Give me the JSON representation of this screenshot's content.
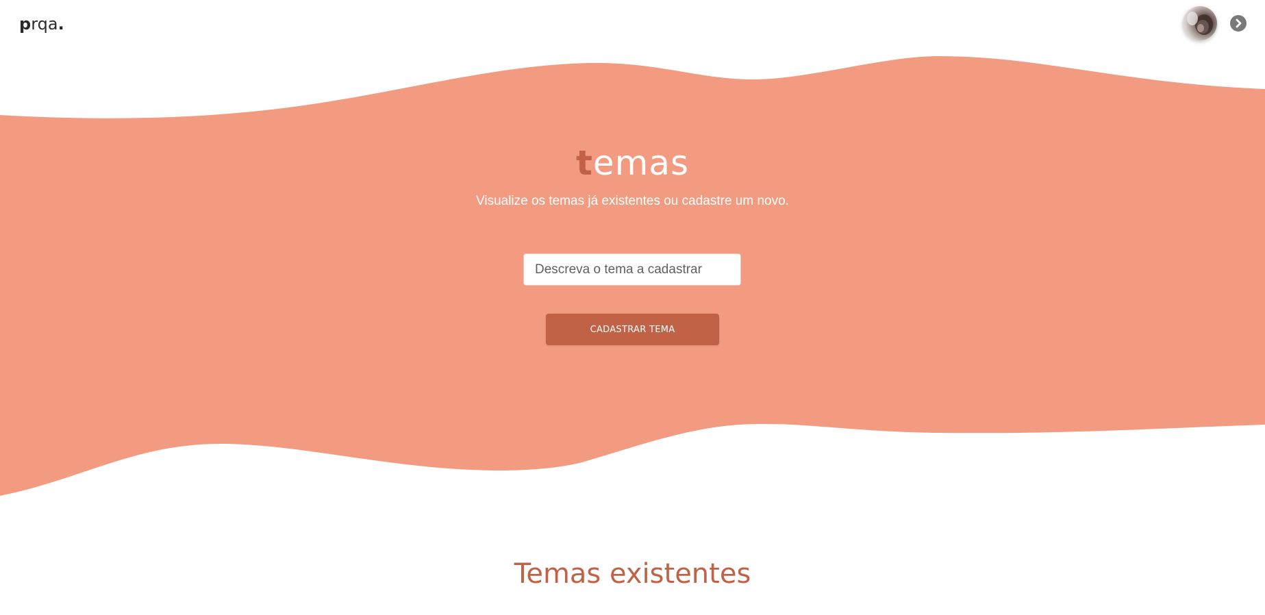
{
  "header": {
    "logo_bold": "p",
    "logo_rest": "rqa",
    "logo_dot": "."
  },
  "hero": {
    "title_first": "t",
    "title_rest": "emas",
    "subtitle": "Visualize os temas já existentes ou cadastre um novo.",
    "input_placeholder": "Descreva o tema a cadastrar",
    "input_value": "",
    "button_label": "CADASTRAR TEMA"
  },
  "section": {
    "title": "Temas existentes"
  },
  "colors": {
    "wave": "#f29b80",
    "accent": "#c16145",
    "text_on_wave": "#ffffff"
  },
  "icons": {
    "user": "avatar",
    "logout": "chevron-right-circle-icon"
  }
}
